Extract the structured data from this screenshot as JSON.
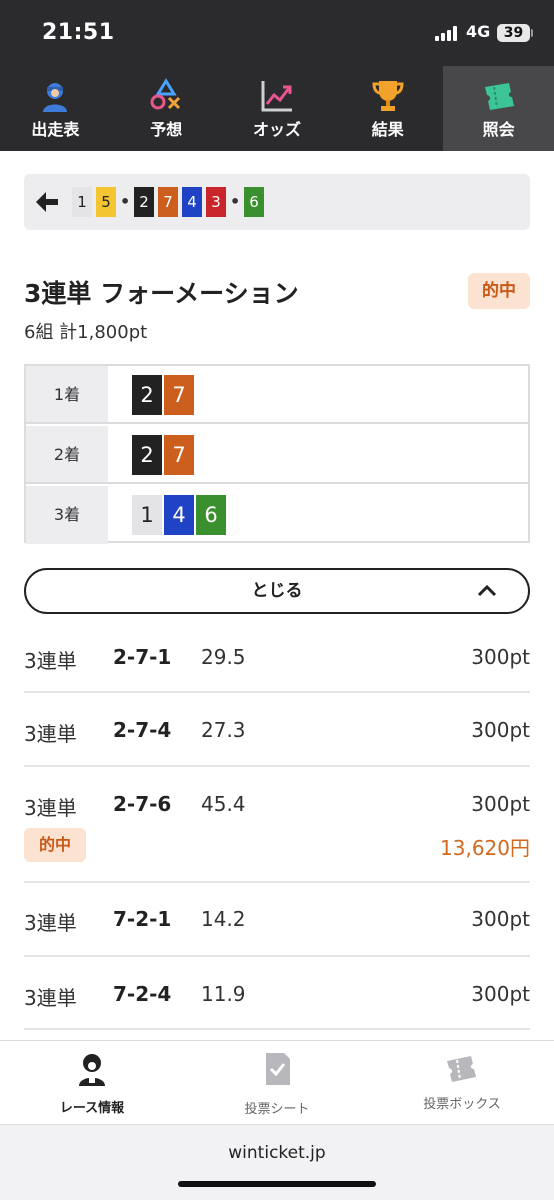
{
  "status_bar": {
    "time": "21:51",
    "network": "4G",
    "battery": "39"
  },
  "top_nav": {
    "tabs": [
      {
        "label": "出走表",
        "icon": "racer-icon"
      },
      {
        "label": "予想",
        "icon": "shapes-icon"
      },
      {
        "label": "オッズ",
        "icon": "trend-chart-icon"
      },
      {
        "label": "結果",
        "icon": "trophy-icon"
      },
      {
        "label": "照会",
        "icon": "ticket-icon",
        "active": true
      }
    ]
  },
  "ticket_strip": {
    "chips": [
      {
        "num": "1",
        "color": "#e4e4e6",
        "text_color": "#222222"
      },
      {
        "num": "5",
        "color": "#f2c531",
        "text_color": "#222222"
      },
      {
        "num": "2",
        "color": "#222222",
        "text_color": "#ffffff"
      },
      {
        "num": "7",
        "color": "#cc5f1e",
        "text_color": "#ffffff"
      },
      {
        "num": "4",
        "color": "#1f43c4",
        "text_color": "#ffffff"
      },
      {
        "num": "3",
        "color": "#c8262a",
        "text_color": "#ffffff"
      },
      {
        "num": "6",
        "color": "#3a8f2f",
        "text_color": "#ffffff"
      }
    ],
    "separator": "•"
  },
  "bet_summary": {
    "title": "3連単 フォーメーション",
    "status_badge": "的中",
    "subtitle": "6組 計1,800pt"
  },
  "formation": [
    {
      "position": "1着",
      "numbers": [
        "2",
        "7"
      ]
    },
    {
      "position": "2着",
      "numbers": [
        "2",
        "7"
      ]
    },
    {
      "position": "3着",
      "numbers": [
        "1",
        "4",
        "6"
      ]
    }
  ],
  "close_button": {
    "label": "とじる"
  },
  "bets": [
    {
      "type": "3連単",
      "combo": "2-7-1",
      "odds": "29.5",
      "amount": "300pt"
    },
    {
      "type": "3連単",
      "combo": "2-7-4",
      "odds": "27.3",
      "amount": "300pt"
    },
    {
      "type": "3連単",
      "combo": "2-7-6",
      "odds": "45.4",
      "amount": "300pt",
      "hit_badge": "的中",
      "payout": "13,620円"
    },
    {
      "type": "3連単",
      "combo": "7-2-1",
      "odds": "14.2",
      "amount": "300pt"
    },
    {
      "type": "3連単",
      "combo": "7-2-4",
      "odds": "11.9",
      "amount": "300pt"
    }
  ],
  "bottom_nav": {
    "items": [
      {
        "label": "レース情報",
        "icon": "racer-icon",
        "active": true
      },
      {
        "label": "投票シート",
        "icon": "checked-sheet-icon"
      },
      {
        "label": "投票ボックス",
        "icon": "ticket-box-icon"
      }
    ]
  },
  "url_bar": {
    "url": "winticket.jp"
  },
  "colors": {
    "dark_bg": "#2b2b2e",
    "hit_badge_bg": "#fbe2d1",
    "hit_text": "#c85a18",
    "payout_text": "#d2691e"
  }
}
